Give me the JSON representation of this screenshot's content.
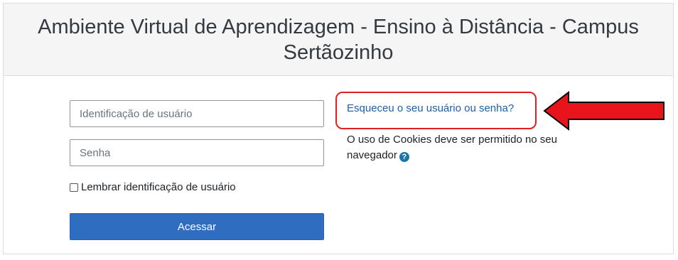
{
  "header": {
    "title": "Ambiente Virtual de Aprendizagem - Ensino à Distância - Campus Sertãozinho"
  },
  "login": {
    "username_placeholder": "Identificação de usuário",
    "username_value": "",
    "password_placeholder": "Senha",
    "password_value": "",
    "remember_label": "Lembrar identificação de usuário",
    "remember_checked": false,
    "submit_label": "Acessar"
  },
  "side": {
    "forgot_link": "Esqueceu o seu usuário ou senha?",
    "cookies_text": "O uso de Cookies deve ser permitido no seu navegador",
    "help_icon": "question-circle-icon"
  },
  "colors": {
    "primary": "#2f6dc0",
    "link": "#1f5fa8",
    "annotation_red": "#e02020",
    "help_icon": "#1b75a8"
  }
}
